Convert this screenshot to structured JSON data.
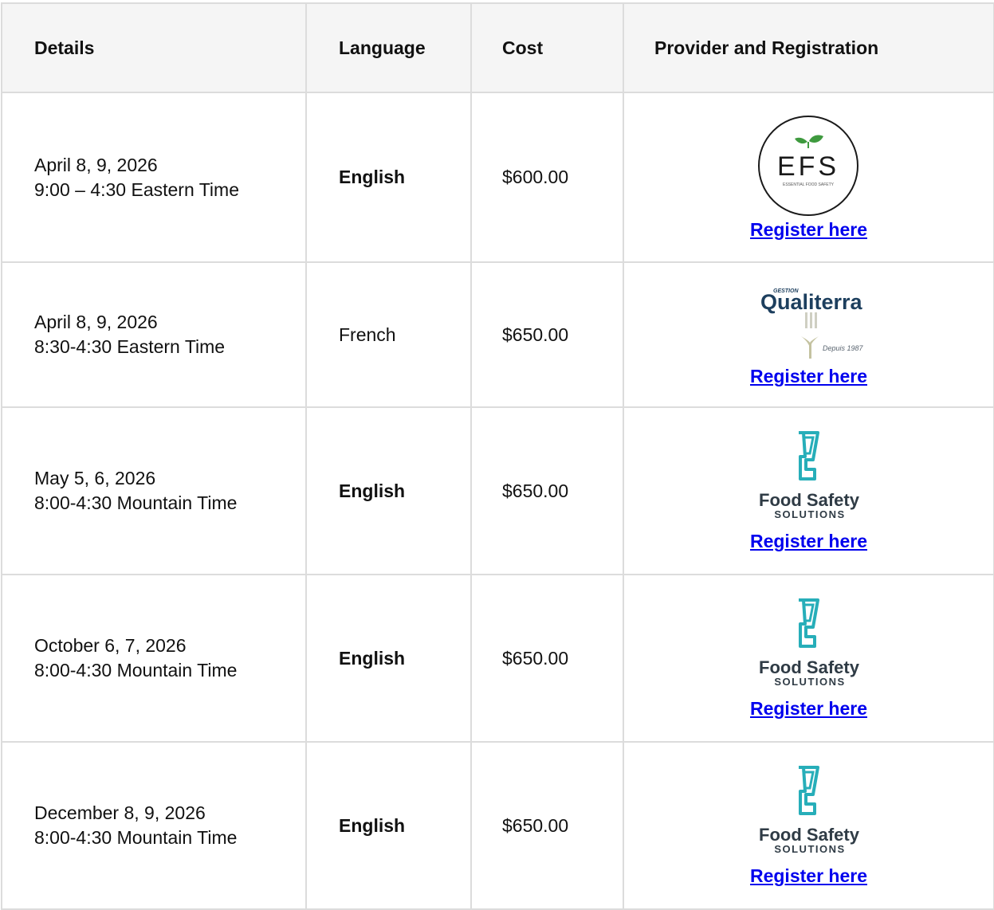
{
  "headers": {
    "details": "Details",
    "language": "Language",
    "cost": "Cost",
    "provider": "Provider and Registration"
  },
  "rows": [
    {
      "date": "April 8, 9, 2026",
      "time": "9:00 – 4:30 Eastern Time",
      "language": "English",
      "cost": "$600.00",
      "provider_logo": "efs-logo",
      "register": "Register here"
    },
    {
      "date": "April 8, 9, 2026",
      "time": "8:30-4:30 Eastern Time",
      "language": "French",
      "cost": "$650.00",
      "provider_logo": "qualiterra-logo",
      "register": "Register here"
    },
    {
      "date": "May 5, 6, 2026",
      "time": "8:00-4:30 Mountain Time",
      "language": "English",
      "cost": "$650.00",
      "provider_logo": "food-safety-solutions-logo",
      "register": "Register here"
    },
    {
      "date": "October 6, 7, 2026",
      "time": "8:00-4:30 Mountain Time",
      "language": "English",
      "cost": "$650.00",
      "provider_logo": "food-safety-solutions-logo",
      "register": "Register here"
    },
    {
      "date": "December 8, 9, 2026",
      "time": "8:00-4:30 Mountain Time",
      "language": "English",
      "cost": "$650.00",
      "provider_logo": "food-safety-solutions-logo",
      "register": "Register here"
    }
  ],
  "logos": {
    "efs": {
      "text": "EFS",
      "tagline": "ESSENTIAL FOOD SAFETY"
    },
    "qualiterra": {
      "small": "GESTION",
      "name": "Qualiterra",
      "since": "Depuis 1987"
    },
    "fss": {
      "line1": "Food Safety",
      "line2": "SOLUTIONS"
    }
  },
  "colors": {
    "link": "#0000ee",
    "border": "#dcdcdc",
    "header_bg": "#f5f5f5",
    "fss_teal": "#27aeb9",
    "fss_text": "#2f3b45",
    "qualiterra_navy": "#1d3f5e",
    "efs_leaf": "#3f9a3f"
  }
}
